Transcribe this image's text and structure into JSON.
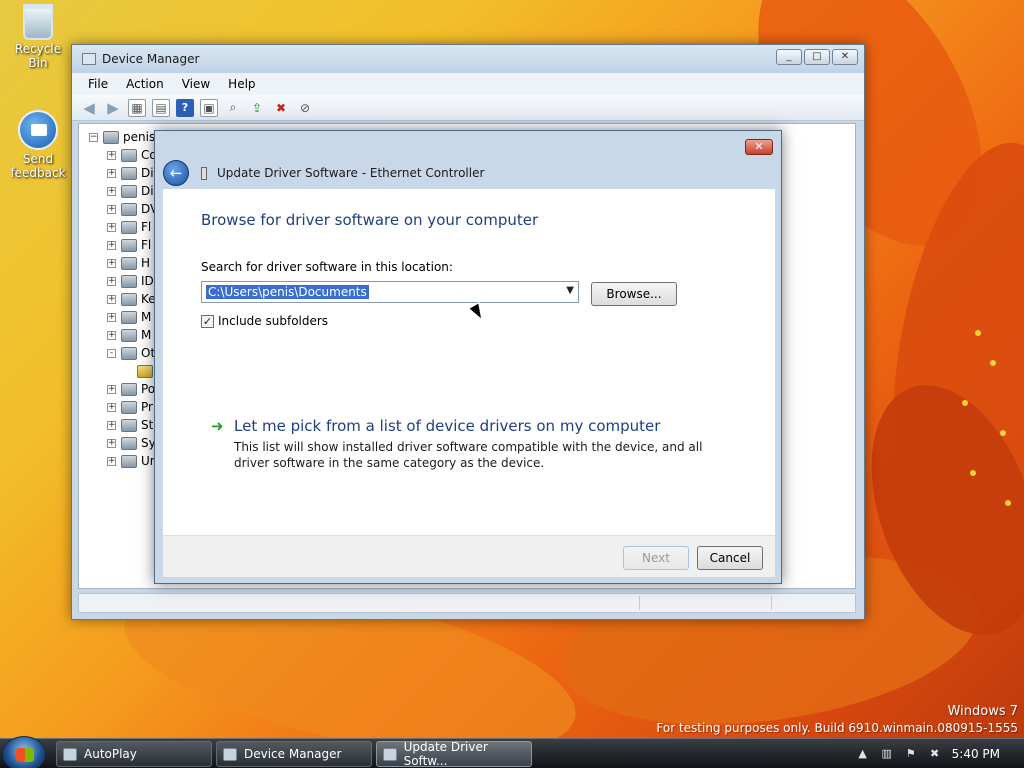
{
  "desktop": {
    "icons": [
      {
        "label": "Recycle Bin",
        "icon": "recycle-bin-icon"
      },
      {
        "label": "Send feedback",
        "icon": "feedback-icon"
      }
    ],
    "watermark": {
      "line1": "Windows 7",
      "line2": "For testing purposes only. Build 6910.winmain.080915-1555"
    }
  },
  "device_manager": {
    "title": "Device Manager",
    "menu": [
      "File",
      "Action",
      "View",
      "Help"
    ],
    "toolbar_icons": [
      "back-arrow-icon",
      "forward-arrow-icon",
      "properties-icon",
      "show-hide-icon",
      "help-icon",
      "view-icon",
      "scan-hardware-icon",
      "update-driver-icon",
      "uninstall-icon",
      "disable-icon"
    ],
    "tree": {
      "root": "penis",
      "items": [
        {
          "expander": "+",
          "label": "Co"
        },
        {
          "expander": "+",
          "label": "Di"
        },
        {
          "expander": "+",
          "label": "Di"
        },
        {
          "expander": "+",
          "label": "DV"
        },
        {
          "expander": "+",
          "label": "Fl"
        },
        {
          "expander": "+",
          "label": "Fl"
        },
        {
          "expander": "+",
          "label": "H"
        },
        {
          "expander": "+",
          "label": "ID"
        },
        {
          "expander": "+",
          "label": "Ke"
        },
        {
          "expander": "+",
          "label": "M"
        },
        {
          "expander": "+",
          "label": "M"
        },
        {
          "expander": "-",
          "label": "Ot"
        },
        {
          "expander": "",
          "label": ""
        },
        {
          "expander": "+",
          "label": "Po"
        },
        {
          "expander": "+",
          "label": "Pr"
        },
        {
          "expander": "+",
          "label": "St"
        },
        {
          "expander": "+",
          "label": "Sy"
        },
        {
          "expander": "+",
          "label": "Ur"
        }
      ]
    }
  },
  "dialog": {
    "title": "Update Driver Software - Ethernet Controller",
    "heading": "Browse for driver software on your computer",
    "search_label": "Search for driver software in this location:",
    "path_value": "C:\\Users\\penis\\Documents",
    "browse_label": "Browse...",
    "include_subfolders_label": "Include subfolders",
    "include_subfolders_checked": true,
    "pick_title": "Let me pick from a list of device drivers on my computer",
    "pick_description": "This list will show installed driver software compatible with the device, and all driver software in the same category as the device.",
    "next_label": "Next",
    "cancel_label": "Cancel"
  },
  "taskbar": {
    "buttons": [
      {
        "label": "AutoPlay",
        "icon": "autoplay-icon",
        "active": false
      },
      {
        "label": "Device Manager",
        "icon": "device-manager-icon",
        "active": false
      },
      {
        "label": "Update Driver Softw...",
        "icon": "update-driver-icon",
        "active": true
      }
    ],
    "clock": "5:40 PM"
  },
  "colors": {
    "heading_blue": "#1e3f83",
    "selection_blue": "#3a6fd1",
    "link_arrow_green": "#2b9a2e"
  }
}
